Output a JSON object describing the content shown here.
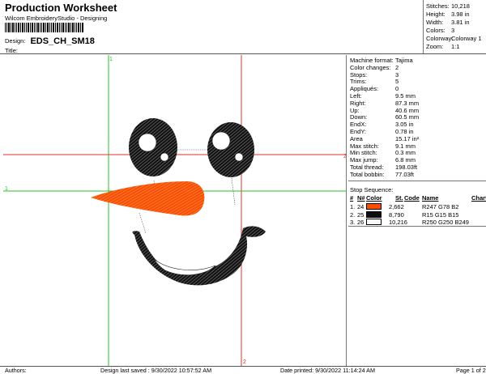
{
  "header": {
    "title": "Production Worksheet",
    "subtitle": "Wilcom EmbroideryStudio - Designing",
    "design_label": "Design:",
    "design_value": "EDS_CH_SM18",
    "title_label": "Title:"
  },
  "summary": [
    {
      "label": "Stitches:",
      "value": "10,218"
    },
    {
      "label": "Height:",
      "value": "3.98 in"
    },
    {
      "label": "Width:",
      "value": "3.81 in"
    },
    {
      "label": "Colors:",
      "value": "3"
    },
    {
      "label": "Colorway:",
      "value": "Colorway 1"
    },
    {
      "label": "Zoom:",
      "value": "1:1"
    }
  ],
  "canvas": {
    "guide_labels": {
      "top": "1",
      "right": "2",
      "left": "1",
      "bottom": "2"
    },
    "colors": {
      "orange": "#F74E02",
      "black": "#0F0F0F",
      "guide_green": "#29C229",
      "guide_red": "#E03030"
    }
  },
  "stats": [
    {
      "label": "Machine format:",
      "value": "Tajima"
    },
    {
      "label": "Color changes:",
      "value": "2"
    },
    {
      "label": "Stops:",
      "value": "3"
    },
    {
      "label": "Trims:",
      "value": "5"
    },
    {
      "label": "Appliqués:",
      "value": "0"
    },
    {
      "label": "Left:",
      "value": "9.5 mm"
    },
    {
      "label": "Right:",
      "value": "87.3 mm"
    },
    {
      "label": "Up:",
      "value": "40.6 mm"
    },
    {
      "label": "Down:",
      "value": "60.5 mm"
    },
    {
      "label": "EndX:",
      "value": "3.05 in"
    },
    {
      "label": "EndY:",
      "value": "0.78 in"
    },
    {
      "label": "Area",
      "value": "15.17 in²"
    },
    {
      "label": "Max stitch:",
      "value": "9.1 mm"
    },
    {
      "label": "Min stitch:",
      "value": "0.3 mm"
    },
    {
      "label": "Max jump:",
      "value": "6.8 mm"
    },
    {
      "label": "Total thread:",
      "value": "198.03ft"
    },
    {
      "label": "Total bobbin:",
      "value": "77.03ft"
    }
  ],
  "stop_sequence": {
    "title": "Stop Sequence:",
    "headers": {
      "num": "#",
      "n": "N#",
      "color": "Color",
      "st": "St.",
      "code": "Code",
      "name": "Name",
      "chart": "Chart"
    },
    "rows": [
      {
        "num": "1.",
        "n": "24",
        "color": "#F74E02",
        "st": "2,662",
        "name": "R247 G78 B2"
      },
      {
        "num": "2.",
        "n": "25",
        "color": "#0F0F0F",
        "st": "8,790",
        "name": "R15 G15 B15"
      },
      {
        "num": "3.",
        "n": "26",
        "color": "#FAFAF9",
        "st": "10,216",
        "name": "R250 G250 B249"
      }
    ]
  },
  "footer": {
    "authors": "Authors:",
    "saved": "Design last saved : 9/30/2022 10:57:52 AM",
    "printed": "Date printed: 9/30/2022 11:14:24 AM",
    "page": "Page 1 of 2"
  }
}
